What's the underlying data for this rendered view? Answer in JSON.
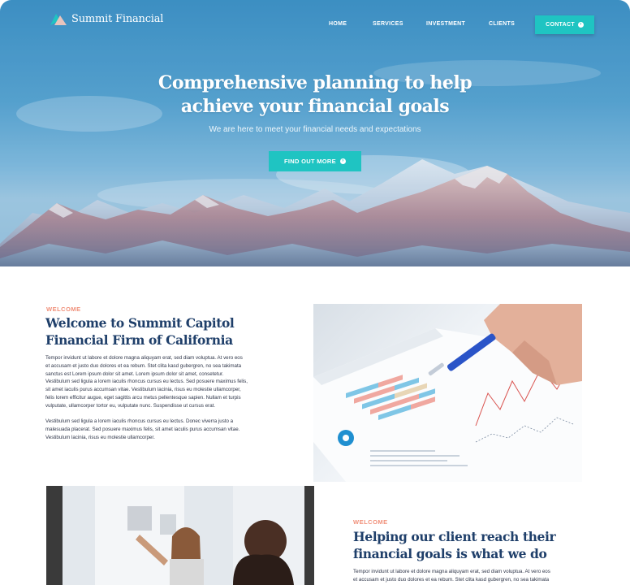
{
  "brand": {
    "name": "Summit Financial",
    "accent": "#1fc4c2",
    "heading_color": "#1f3f6a",
    "eyebrow_color": "#f0907a"
  },
  "nav": {
    "items": [
      {
        "label": "HOME"
      },
      {
        "label": "SERVICES"
      },
      {
        "label": "INVESTMENT"
      },
      {
        "label": "CLIENTS"
      }
    ],
    "contact_label": "CONTACT",
    "contact_icon": "arrow-circle-right-icon"
  },
  "hero": {
    "title_line1": "Comprehensive planning to help",
    "title_line2": "achieve your financial goals",
    "subtitle": "We are here to meet your financial needs and expectations",
    "cta_label": "FIND OUT MORE",
    "cta_icon": "arrow-circle-right-icon"
  },
  "welcome": {
    "eyebrow": "WELCOME",
    "title_line1": "Welcome to Summit Capitol",
    "title_line2": "Financial Firm of California",
    "paragraph1_lines": [
      "Tempor invidunt ut labore et dolore magna aliquyam erat, sed diam voluptua. At vero eos",
      "et accusam et justo duo dolores et ea rebum. Stet clita kasd gubergren, no sea takimata",
      "sanctus est Lorem ipsum dolor sit amet. Lorem ipsum dolor sit amet, consetetur.",
      "Vestibulum sed ligula a lorem iaculis rhoncus cursus eu lectus. Sed posuere maximus felis,",
      "sit amet iaculis purus accumsan vitae. Vestibulum lacinia, risus eu molestie ullamcorper,",
      "felis lorem efficitur augue, eget sagittis arcu metus pellentesque sapien. Nullam et turpis",
      "vulputate, ullamcorper tortor eu, vulputate nunc. Suspendisse ut cursus erat."
    ],
    "paragraph2_lines": [
      "Vestibulum sed ligula a lorem iaculis rhoncus cursus eu lectus. Donec viverra justo a",
      "malesuada placerat. Sed posuere maximus felis, sit amet iaculis purus accumsan vitae.",
      "Vestibulum lacinia, risus eu molestie ullamcorper."
    ]
  },
  "helping": {
    "eyebrow": "WELCOME",
    "title_line1": "Helping our client reach their",
    "title_line2": "financial goals is what we do",
    "paragraph_lines": [
      "Tempor invidunt ut labore et dolore magna aliquyam erat, sed diam voluptua. At vero eos",
      "et accusam et justo duo dolores et ea rebum. Stet clita kasd gubergren, no sea takimata"
    ]
  }
}
